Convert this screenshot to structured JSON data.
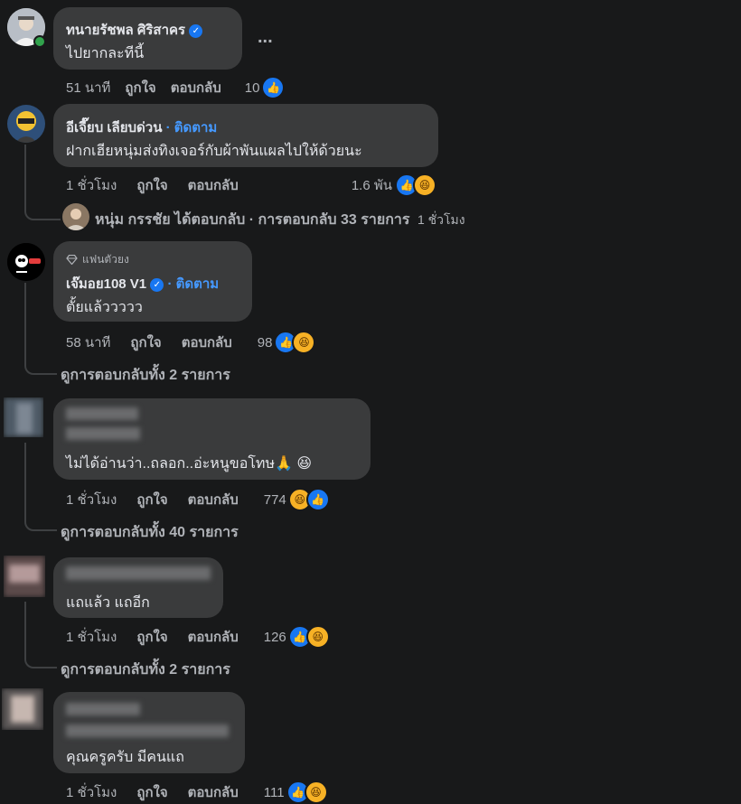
{
  "comments": [
    {
      "author": "ทนายรัชพล ศิริสาคร",
      "text": "ไปยากละทีนี้",
      "more": "...",
      "time": "51 นาที",
      "like_label": "ถูกใจ",
      "reply_label": "ตอบกลับ",
      "reaction_count": "10",
      "reactions": [
        "like"
      ]
    },
    {
      "author": "อีเจี๊ยบ เลียบด่วน",
      "follow_label": "· ติดตาม",
      "text": "ฝากเฮียหนุ่มส่งทิงเจอร์กับผ้าพันแผลไปให้ด้วยนะ",
      "time": "1 ชั่วโมง",
      "like_label": "ถูกใจ",
      "reply_label": "ตอบกลับ",
      "reaction_count": "1.6 พัน",
      "reactions": [
        "like",
        "haha"
      ],
      "reply_summary": {
        "name": "หนุ่ม กรรชัย",
        "text": "ได้ตอบกลับ · การตอบกลับ 33 รายการ",
        "time": "1 ชั่วโมง"
      }
    },
    {
      "badge": "แฟนตัวยง",
      "author": "เจ๊มอย108 V1",
      "follow_label": "· ติดตาม",
      "text": "ตั้ยแล้ววววว",
      "time": "58 นาที",
      "like_label": "ถูกใจ",
      "reply_label": "ตอบกลับ",
      "reaction_count": "98",
      "reactions": [
        "like",
        "haha"
      ],
      "view_replies": "ดูการตอบกลับทั้ง 2 รายการ"
    },
    {
      "text": "ไม่ได้อ่านว่า..ถลอก..อ่ะหนูขอโทษ🙏 😆",
      "time": "1 ชั่วโมง",
      "like_label": "ถูกใจ",
      "reply_label": "ตอบกลับ",
      "reaction_count": "774",
      "reactions": [
        "haha",
        "like"
      ],
      "view_replies": "ดูการตอบกลับทั้ง 40 รายการ"
    },
    {
      "text": "แถแล้ว แถอีก",
      "time": "1 ชั่วโมง",
      "like_label": "ถูกใจ",
      "reply_label": "ตอบกลับ",
      "reaction_count": "126",
      "reactions": [
        "like",
        "haha"
      ],
      "view_replies": "ดูการตอบกลับทั้ง 2 รายการ"
    },
    {
      "text": "คุณครูครับ มีคนแถ",
      "time": "1 ชั่วโมง",
      "like_label": "ถูกใจ",
      "reply_label": "ตอบกลับ",
      "reaction_count": "111",
      "reactions": [
        "like",
        "haha"
      ]
    }
  ],
  "colors": {
    "background": "#18191a",
    "bubble": "#3a3b3c",
    "link": "#4599ff",
    "like": "#1877f2",
    "haha": "#f7b125",
    "online": "#31a24c"
  },
  "icons": [
    "verified-badge-icon",
    "like-reaction-icon",
    "haha-reaction-icon",
    "diamond-badge-icon",
    "more-options-icon"
  ]
}
